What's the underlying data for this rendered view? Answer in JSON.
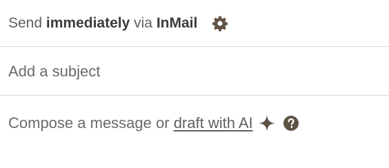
{
  "send": {
    "prefix": "Send",
    "timing": "immediately",
    "middle": "via",
    "channel": "InMail",
    "settings_icon": "gear-icon"
  },
  "subject": {
    "placeholder": "Add a subject",
    "value": ""
  },
  "compose": {
    "prefix": "Compose a message or",
    "ai_link": "draft with AI",
    "ai_icon": "sparkle-icon",
    "help_icon": "question-circle-icon"
  },
  "colors": {
    "text": "#5f5f5f",
    "icon": "#5e5344",
    "divider": "#dcdcdc"
  }
}
